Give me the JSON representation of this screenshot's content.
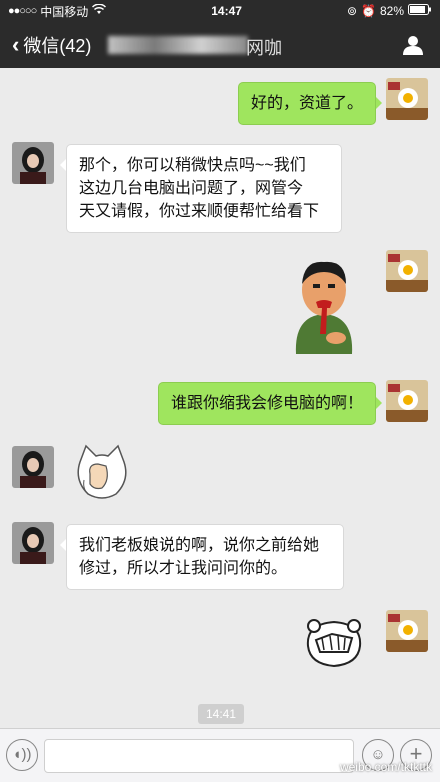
{
  "status": {
    "carrier": "中国移动",
    "time": "14:47",
    "battery": "82%",
    "signal_dots": "●●○○○"
  },
  "nav": {
    "back_label": "微信(42)",
    "title_tail": "网咖",
    "profile_icon": "person-icon"
  },
  "messages": [
    {
      "side": "out",
      "type": "text",
      "text": "好的，资道了。"
    },
    {
      "side": "in",
      "type": "text",
      "lines": [
        "那个，你可以稍微快点吗~~我们",
        "这边几台电脑出问题了，网管今",
        "天又请假，你过来顺便帮忙给看下"
      ]
    },
    {
      "side": "out",
      "type": "sticker",
      "sticker": "bleeding-man-sticker"
    },
    {
      "side": "out",
      "type": "text",
      "text": "谁跟你缩我会修电脑的啊！"
    },
    {
      "side": "in",
      "type": "sticker",
      "sticker": "cat-facepalm-sticker"
    },
    {
      "side": "in",
      "type": "text",
      "lines": [
        "我们老板娘说的啊，说你之前给她",
        "修过，所以才让我问问你的。"
      ]
    },
    {
      "side": "out",
      "type": "sticker",
      "sticker": "bear-facepalm-sticker"
    }
  ],
  "timestamp": "14:41",
  "watermark": "weibo.com/tktkttk",
  "colors": {
    "out_bubble": "#9fe55e",
    "in_bubble": "#ffffff",
    "bar": "#2b2b2b"
  }
}
